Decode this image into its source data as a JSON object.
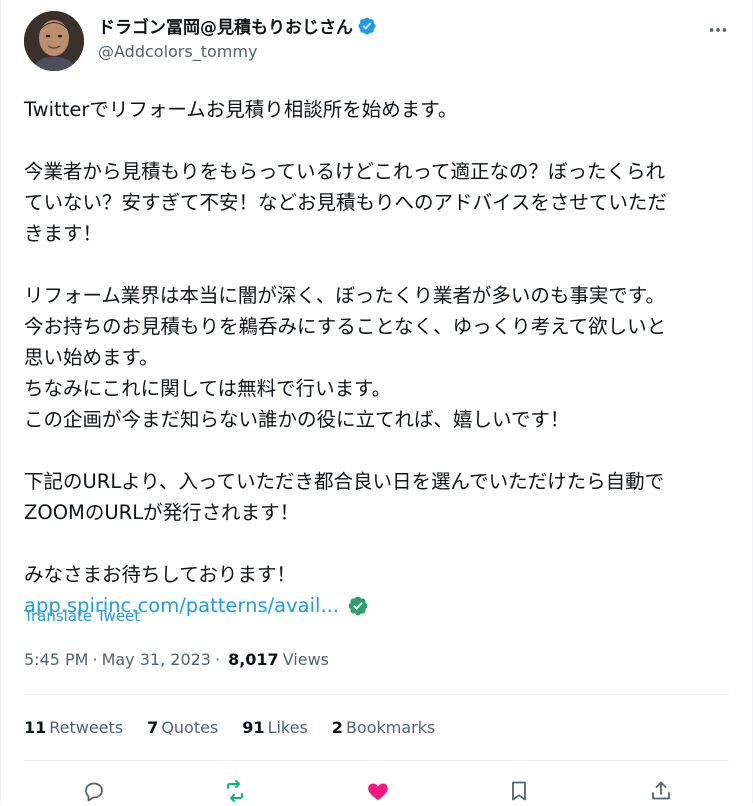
{
  "author": {
    "display_name": "ドラゴン冨岡@見積もりおじさん",
    "handle": "@Addcolors_tommy"
  },
  "tweet": {
    "paragraphs": [
      [
        "Twitterでリフォームお見積り相談所を始めます。"
      ],
      [
        "今業者から見積もりをもらっているけどこれって適正なの？ぼったくられ",
        "ていない？安すぎて不安！などお見積もりへのアドバイスをさせていただ",
        "きます！"
      ],
      [
        "リフォーム業界は本当に闇が深く、ぼったくり業者が多いのも事実です。",
        "今お持ちのお見積もりを鵜呑みにすることなく、ゆっくり考えて欲しいと",
        "思い始めます。",
        "ちなみにこれに関しては無料で行います。",
        "この企画が今まだ知らない誰かの役に立てれば、嬉しいです！"
      ],
      [
        "下記のURLより、入っていただき都合良い日を選んでいただけたら自動で",
        "ZOOMのURLが発行されます！"
      ],
      [
        "みなさまお待ちしております！"
      ]
    ],
    "link_text": "app.spirinc.com/patterns/avail...",
    "translate_label": "Translate Tweet",
    "time": "5:45 PM",
    "date": "May 31, 2023",
    "views_count": "8,017",
    "views_label": "Views"
  },
  "stats": {
    "retweets": {
      "num": "11",
      "label": "Retweets"
    },
    "quotes": {
      "num": "7",
      "label": "Quotes"
    },
    "likes": {
      "num": "91",
      "label": "Likes"
    },
    "bookmarks": {
      "num": "2",
      "label": "Bookmarks"
    }
  },
  "colors": {
    "accent": "#1d9bf0",
    "retweet_active": "#00ba7c",
    "like_active": "#f91880",
    "muted": "#536471"
  },
  "icons": [
    "verified-badge-icon",
    "more-icon",
    "link-check-icon",
    "reply-icon",
    "retweet-icon",
    "like-icon",
    "bookmark-icon",
    "share-icon"
  ]
}
